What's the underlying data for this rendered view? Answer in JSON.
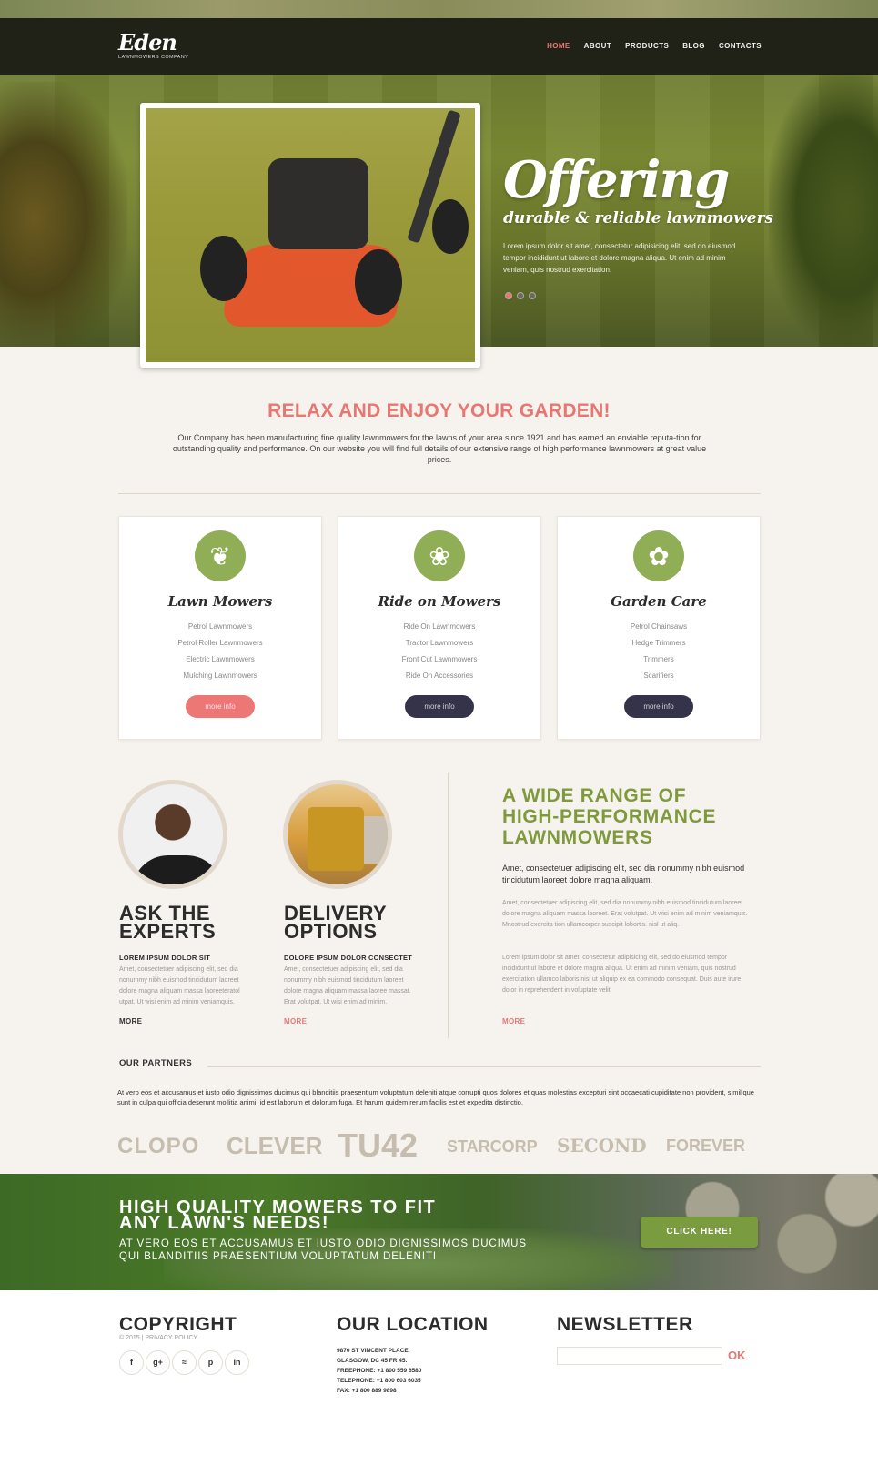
{
  "header": {
    "logo_title": "Eden",
    "logo_subtitle": "LAWNMOWERS COMPANY",
    "nav": [
      "HOME",
      "ABOUT",
      "PRODUCTS",
      "BLOG",
      "CONTACTS"
    ],
    "active_nav": "HOME"
  },
  "hero": {
    "title": "Offering",
    "subtitle": "durable & reliable lawnmowers",
    "text": "Lorem ipsum dolor sit amet, consectetur adipisicing elit, sed do eiusmod tempor incididunt ut labore et dolore magna aliqua. Ut enim ad minim veniam, quis nostrud exercitation.",
    "slides": 3,
    "active_slide": 1
  },
  "intro": {
    "title": "RELAX AND ENJOY YOUR GARDEN!",
    "text": "Our Company has been manufacturing fine quality lawnmowers for the lawns of your area since 1921 and has earned an enviable reputa-tion for outstanding quality and performance. On our website you will find full details of our extensive range of high performance lawnmowers at great value prices."
  },
  "cards": [
    {
      "title": "Lawn Mowers",
      "icon": "leaf-icon",
      "items": [
        "Petrol Lawnmowers",
        "Petrol Roller Lawnmowers",
        "Electric Lawnmowers",
        "Mulching Lawnmowers"
      ],
      "button": "more info"
    },
    {
      "title": "Ride on Mowers",
      "icon": "person-leaf-icon",
      "items": [
        "Ride On Lawnmowers",
        "Tractor Lawnmowers",
        "Front Cut Lawnmowers",
        "Ride On Accessories"
      ],
      "button": "more info"
    },
    {
      "title": "Garden Care",
      "icon": "flower-icon",
      "items": [
        "Petrol Chainsaws",
        "Hedge Trimmers",
        "Trimmers",
        "Scarifiers"
      ],
      "button": "more info"
    }
  ],
  "experts": {
    "title_line1": "ASK THE",
    "title_line2": "EXPERTS",
    "sub": "LOREM IPSUM DOLOR SIT",
    "text": "Amet, consectetuer adipiscing elit, sed dia nonummy nibh euismod tincidutum laoreet dolore magna aliquam massa laoreeteratol utpat. Ut wisi enim ad minim veniamquis.",
    "more": "MORE"
  },
  "delivery": {
    "title_line1": "DELIVERY",
    "title_line2": "OPTIONS",
    "sub": "DOLORE IPSUM DOLOR CONSECTET",
    "text": "Amet, consectetuer adipiscing elit, sed dia nonummy nibh euismod tincidutum laoreet dolore magna aliquam massa laoree massat. Erat volutpat. Ut wisi enim ad minim.",
    "more": "MORE"
  },
  "range": {
    "title_line1": "A WIDE RANGE OF",
    "title_line2": "HIGH-PERFORMANCE",
    "title_line3": "LAWNMOWERS",
    "lead": "Amet, consectetuer adipiscing elit, sed dia nonummy nibh euismod tincidutum laoreet dolore magna aliquam.",
    "p1": "Amet, consectetuer adipiscing elit, sed dia nonummy nibh euismod tincidutum laoreet dolore magna aliquam massa laoreet. Erat volutpat. Ut wisi enim ad minim veniamquis. Mnostrud exercita tion ullamcorper suscipit lobortis. nisl ut aliq.",
    "p2": "Lorem ipsum dolor sit amet, consectetur adipisicing elit, sed do eiusmod tempor incididunt ut labore et dolore magna aliqua. Ut enim ad minim veniam, quis nostrud exercitation ullamco laboris nisi ut aliquip ex ea commodo consequat. Duis aute irure dolor in reprehenderit in voluptate velit",
    "more": "MORE"
  },
  "partners": {
    "heading": "OUR PARTNERS",
    "text": "At vero eos et accusamus et iusto odio dignissimos ducimus qui blanditiis praesentium voluptatum deleniti atque corrupti quos dolores et quas molestias excepturi sint occaecati cupiditate non provident, similique sunt in culpa qui officia deserunt mollitia animi, id est laborum et dolorum fuga. Et harum quidem rerum facilis est et expedita distinctio.",
    "logos": [
      "CLOPO",
      "CLEVER",
      "TU42",
      "STARCORP",
      "SECOND",
      "FOREVER"
    ]
  },
  "banner": {
    "title_line1": "HIGH QUALITY MOWERS TO FIT",
    "title_line2": "ANY LAWN'S NEEDS!",
    "sub_line1": "AT VERO EOS ET ACCUSAMUS ET IUSTO ODIO DIGNISSIMOS DUCIMUS",
    "sub_line2": "QUI BLANDITIIS PRAESENTIUM VOLUPTATUM DELENITI",
    "button": "CLICK HERE!"
  },
  "footer": {
    "copyright_title": "COPYRIGHT",
    "copyright_sub": "© 2015 | PRIVACY POLICY",
    "social": [
      {
        "icon": "facebook-icon",
        "glyph": "f"
      },
      {
        "icon": "google-plus-icon",
        "glyph": "g+"
      },
      {
        "icon": "rss-icon",
        "glyph": "≈"
      },
      {
        "icon": "pinterest-icon",
        "glyph": "p"
      },
      {
        "icon": "linkedin-icon",
        "glyph": "in"
      }
    ],
    "location_title": "OUR LOCATION",
    "address_line1": "9870 ST VINCENT PLACE,",
    "address_line2": "GLASGOW, DC 45 FR 45.",
    "freephone": "FREEPHONE:  +1 800 559 6580",
    "telephone": "TELEPHONE:  +1 800 603 6035",
    "fax": "FAX:        +1 800 889 9898",
    "newsletter_title": "NEWSLETTER",
    "newsletter_value": "",
    "newsletter_button": "OK"
  },
  "colors": {
    "accent": "#e87772",
    "green": "#7f9a3c",
    "dark": "#35334a"
  }
}
